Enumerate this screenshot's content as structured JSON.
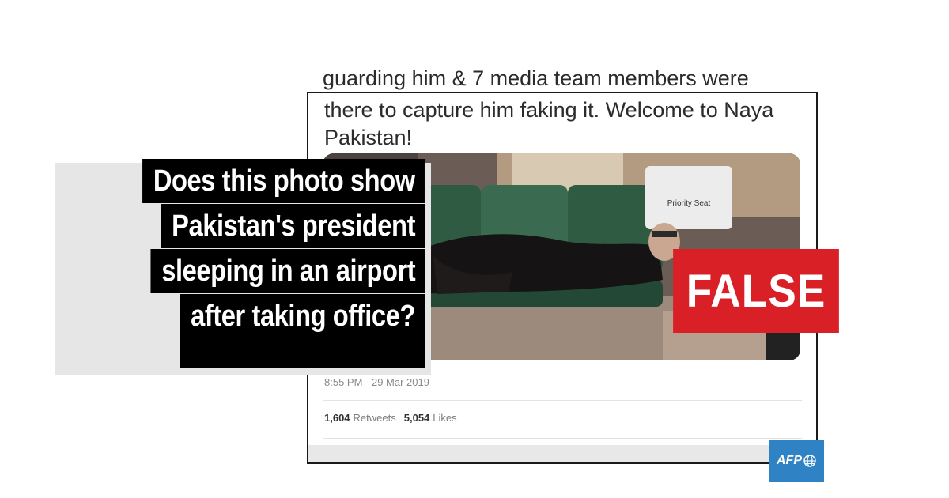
{
  "tweet": {
    "cut_line": "guarding him & 7 media team members were",
    "text": "there to capture him faking it. Welcome to Naya Pakistan!",
    "photo_sign": "Priority Seat",
    "timestamp": "8:55 PM - 29 Mar 2019",
    "retweets_count": "1,604",
    "retweets_label": "Retweets",
    "likes_count": "5,054",
    "likes_label": "Likes"
  },
  "headline": {
    "lines": [
      "Does this photo show",
      "Pakistan's president",
      "sleeping in an airport",
      "after taking office?"
    ]
  },
  "verdict": {
    "label": "FALSE",
    "color": "#d92027"
  },
  "logo": {
    "text": "AFP",
    "icon": "globe-icon",
    "color": "#2f82c4"
  }
}
